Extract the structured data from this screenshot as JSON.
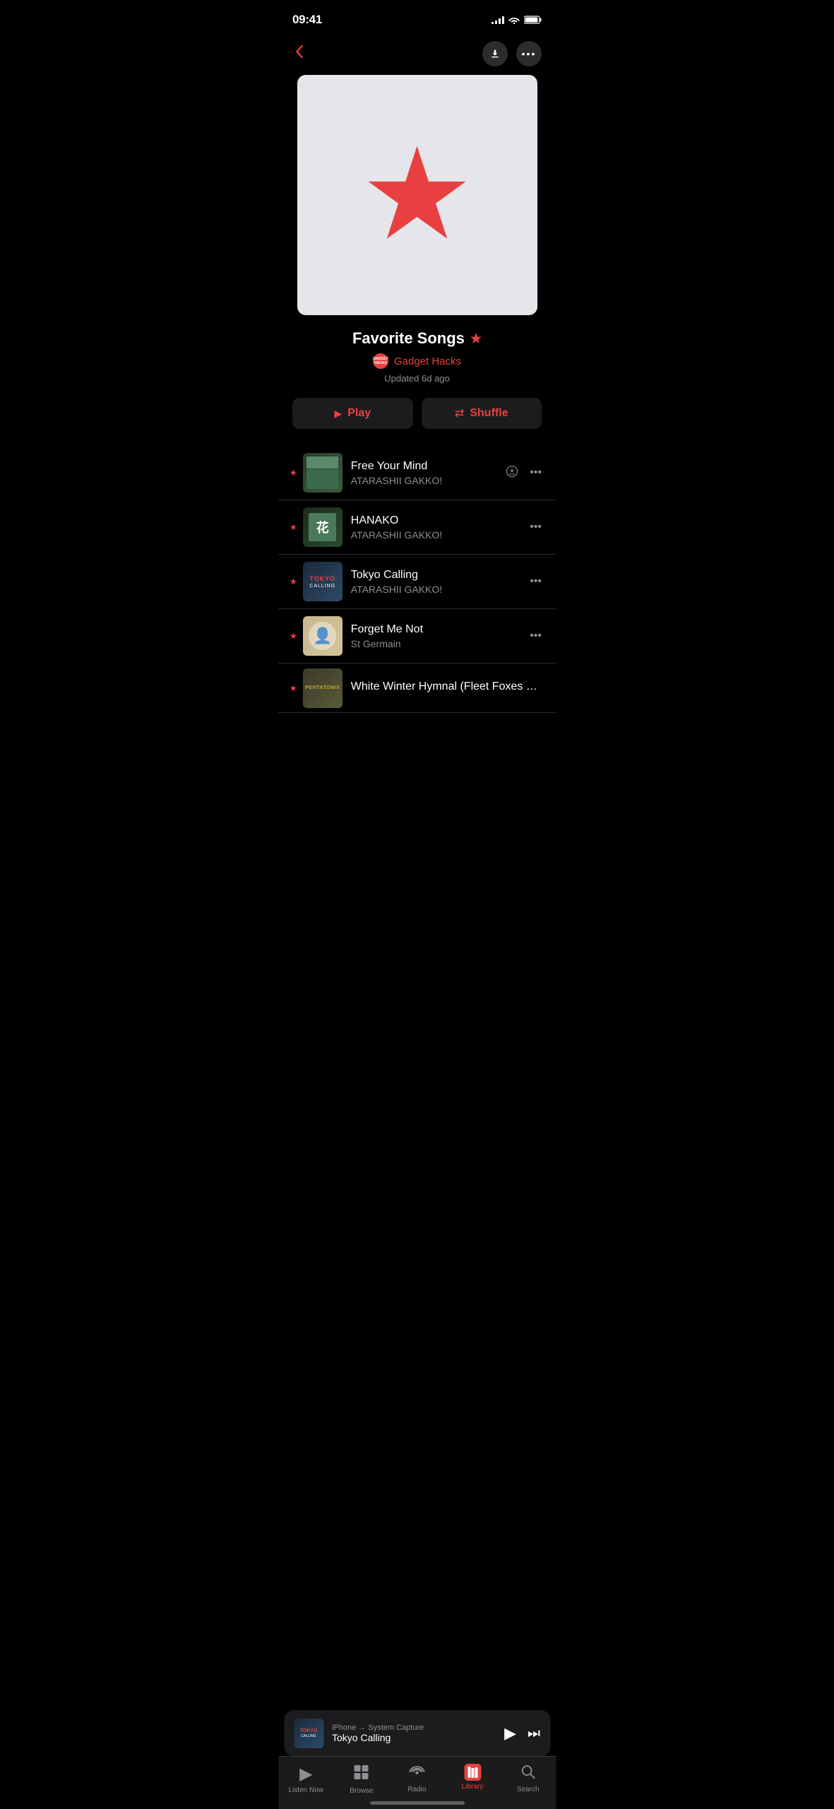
{
  "status": {
    "time": "09:41",
    "signal_bars": [
      3,
      5,
      7,
      10,
      12
    ],
    "battery_full": true
  },
  "nav": {
    "back_label": "‹",
    "download_label": "↓",
    "more_label": "•••"
  },
  "playlist": {
    "title": "Favorite Songs",
    "title_star": "★",
    "author_initials": "GADGET\nHACKS",
    "author_name": "Gadget Hacks",
    "updated": "Updated 6d ago",
    "play_label": "Play",
    "shuffle_label": "Shuffle"
  },
  "tracks": [
    {
      "title": "Free Your Mind",
      "artist": "ATARASHII GAKKO!",
      "has_download": true,
      "starred": true,
      "thumb_class": "thumb-green"
    },
    {
      "title": "HANAKO",
      "artist": "ATARASHII GAKKO!",
      "has_download": false,
      "starred": true,
      "thumb_class": "thumb-dark-green"
    },
    {
      "title": "Tokyo Calling",
      "artist": "ATARASHII GAKKO!",
      "has_download": false,
      "starred": true,
      "thumb_class": "thumb-blue-dark"
    },
    {
      "title": "Forget Me Not",
      "artist": "St Germain",
      "has_download": false,
      "starred": true,
      "thumb_class": "thumb-cream"
    },
    {
      "title": "White Winter Hymnal (Fleet Foxes Cover)",
      "artist": "",
      "has_download": false,
      "starred": true,
      "thumb_class": "thumb-yellow"
    }
  ],
  "mini_player": {
    "source": "iPhone → System Capture",
    "title": "Tokyo Calling"
  },
  "tab_bar": {
    "items": [
      {
        "id": "listen-now",
        "label": "Listen Now",
        "icon": "▶",
        "active": false
      },
      {
        "id": "browse",
        "label": "Browse",
        "icon": "⊞",
        "active": false
      },
      {
        "id": "radio",
        "label": "Radio",
        "icon": "((•))",
        "active": false
      },
      {
        "id": "library",
        "label": "Library",
        "icon": "library",
        "active": true
      },
      {
        "id": "search",
        "label": "Search",
        "icon": "⌕",
        "active": false
      }
    ]
  }
}
